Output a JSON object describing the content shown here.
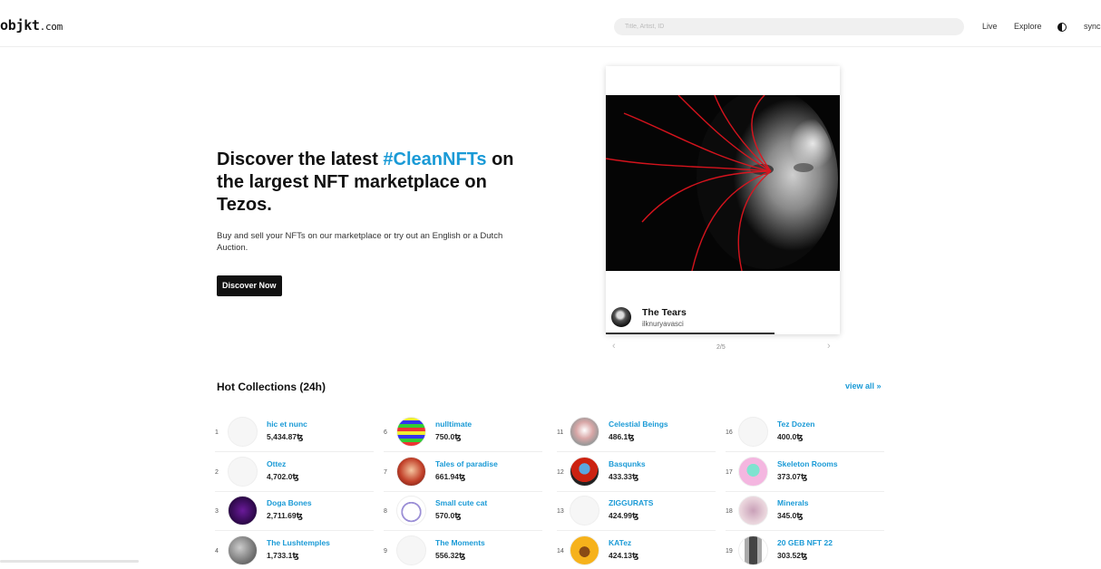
{
  "header": {
    "logo_main": "objkt",
    "logo_tld": ".com",
    "search_placeholder": "Title, Artist, ID",
    "nav": {
      "live": "Live",
      "explore": "Explore",
      "sync": "sync"
    },
    "theme_icon": "contrast-icon"
  },
  "hero": {
    "title_before": "Discover the latest ",
    "title_accent": "#CleanNFTs",
    "title_after": " on the largest NFT marketplace on Tezos.",
    "subtitle": "Buy and sell your NFTs on our marketplace or try out an English or a Dutch Auction.",
    "cta_label": "Discover Now",
    "accent_color": "#1a9ad6"
  },
  "featured": {
    "title": "The Tears",
    "artist": "ilknuryavasci",
    "pager": "2/5",
    "prev_icon": "chevron-left-icon",
    "next_icon": "chevron-right-icon",
    "progress": 0.72
  },
  "hot_collections": {
    "title": "Hot Collections (24h)",
    "view_all": "view all »",
    "columns": [
      [
        {
          "rank": "1",
          "name": "hic et nunc",
          "volume": "5,434.87ꜩ"
        },
        {
          "rank": "2",
          "name": "Ottez",
          "volume": "4,702.0ꜩ"
        },
        {
          "rank": "3",
          "name": "Doga Bones",
          "volume": "2,711.69ꜩ"
        },
        {
          "rank": "4",
          "name": "The Lushtemples",
          "volume": "1,733.1ꜩ"
        }
      ],
      [
        {
          "rank": "6",
          "name": "nulltimate",
          "volume": "750.0ꜩ"
        },
        {
          "rank": "7",
          "name": "Tales of paradise",
          "volume": "661.94ꜩ"
        },
        {
          "rank": "8",
          "name": "Small cute cat",
          "volume": "570.0ꜩ"
        },
        {
          "rank": "9",
          "name": "The Moments",
          "volume": "556.32ꜩ"
        }
      ],
      [
        {
          "rank": "11",
          "name": "Celestial Beings",
          "volume": "486.1ꜩ"
        },
        {
          "rank": "12",
          "name": "Basqunks",
          "volume": "433.33ꜩ"
        },
        {
          "rank": "13",
          "name": "ZIGGURATS",
          "volume": "424.99ꜩ"
        },
        {
          "rank": "14",
          "name": "KATez",
          "volume": "424.13ꜩ"
        }
      ],
      [
        {
          "rank": "16",
          "name": "Tez Dozen",
          "volume": "400.0ꜩ"
        },
        {
          "rank": "17",
          "name": "Skeleton Rooms",
          "volume": "373.07ꜩ"
        },
        {
          "rank": "18",
          "name": "Minerals",
          "volume": "345.0ꜩ"
        },
        {
          "rank": "19",
          "name": "20 GEB NFT 22",
          "volume": "303.52ꜩ"
        }
      ]
    ]
  }
}
